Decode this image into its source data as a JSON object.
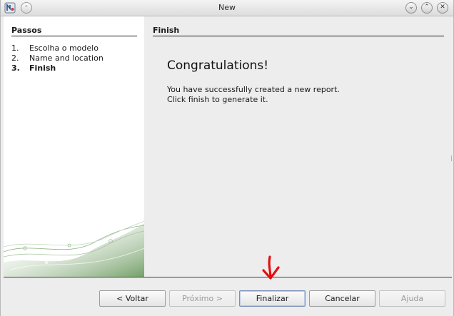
{
  "window": {
    "title": "New",
    "menu_glyph": "◦",
    "minimize_glyph": "⌄",
    "maximize_glyph": "⌃",
    "close_glyph": "✕"
  },
  "steps": {
    "heading": "Passos",
    "items": [
      {
        "num": "1.",
        "label": "Escolha o modelo"
      },
      {
        "num": "2.",
        "label": "Name and location"
      },
      {
        "num": "3.",
        "label": "Finish"
      }
    ],
    "current_index": 2
  },
  "content": {
    "heading": "Finish",
    "title": "Congratulations!",
    "message_line1": "You have successfully created a new report.",
    "message_line2": "Click finish to generate it."
  },
  "buttons": {
    "back": {
      "label": "< Voltar",
      "mnemonic": "V"
    },
    "next": {
      "label": "Próximo >"
    },
    "finish": {
      "label": "Finalizar",
      "mnemonic": "F"
    },
    "cancel": {
      "label": "Cancelar"
    },
    "help": {
      "label": "Ajuda",
      "mnemonic": "A"
    }
  },
  "colors": {
    "annotation_arrow": "#e01010",
    "decor_green": "#5c8f4e"
  },
  "icons": {
    "app": "netbeans-app-icon",
    "annotation": "red-arrow-down-icon"
  }
}
